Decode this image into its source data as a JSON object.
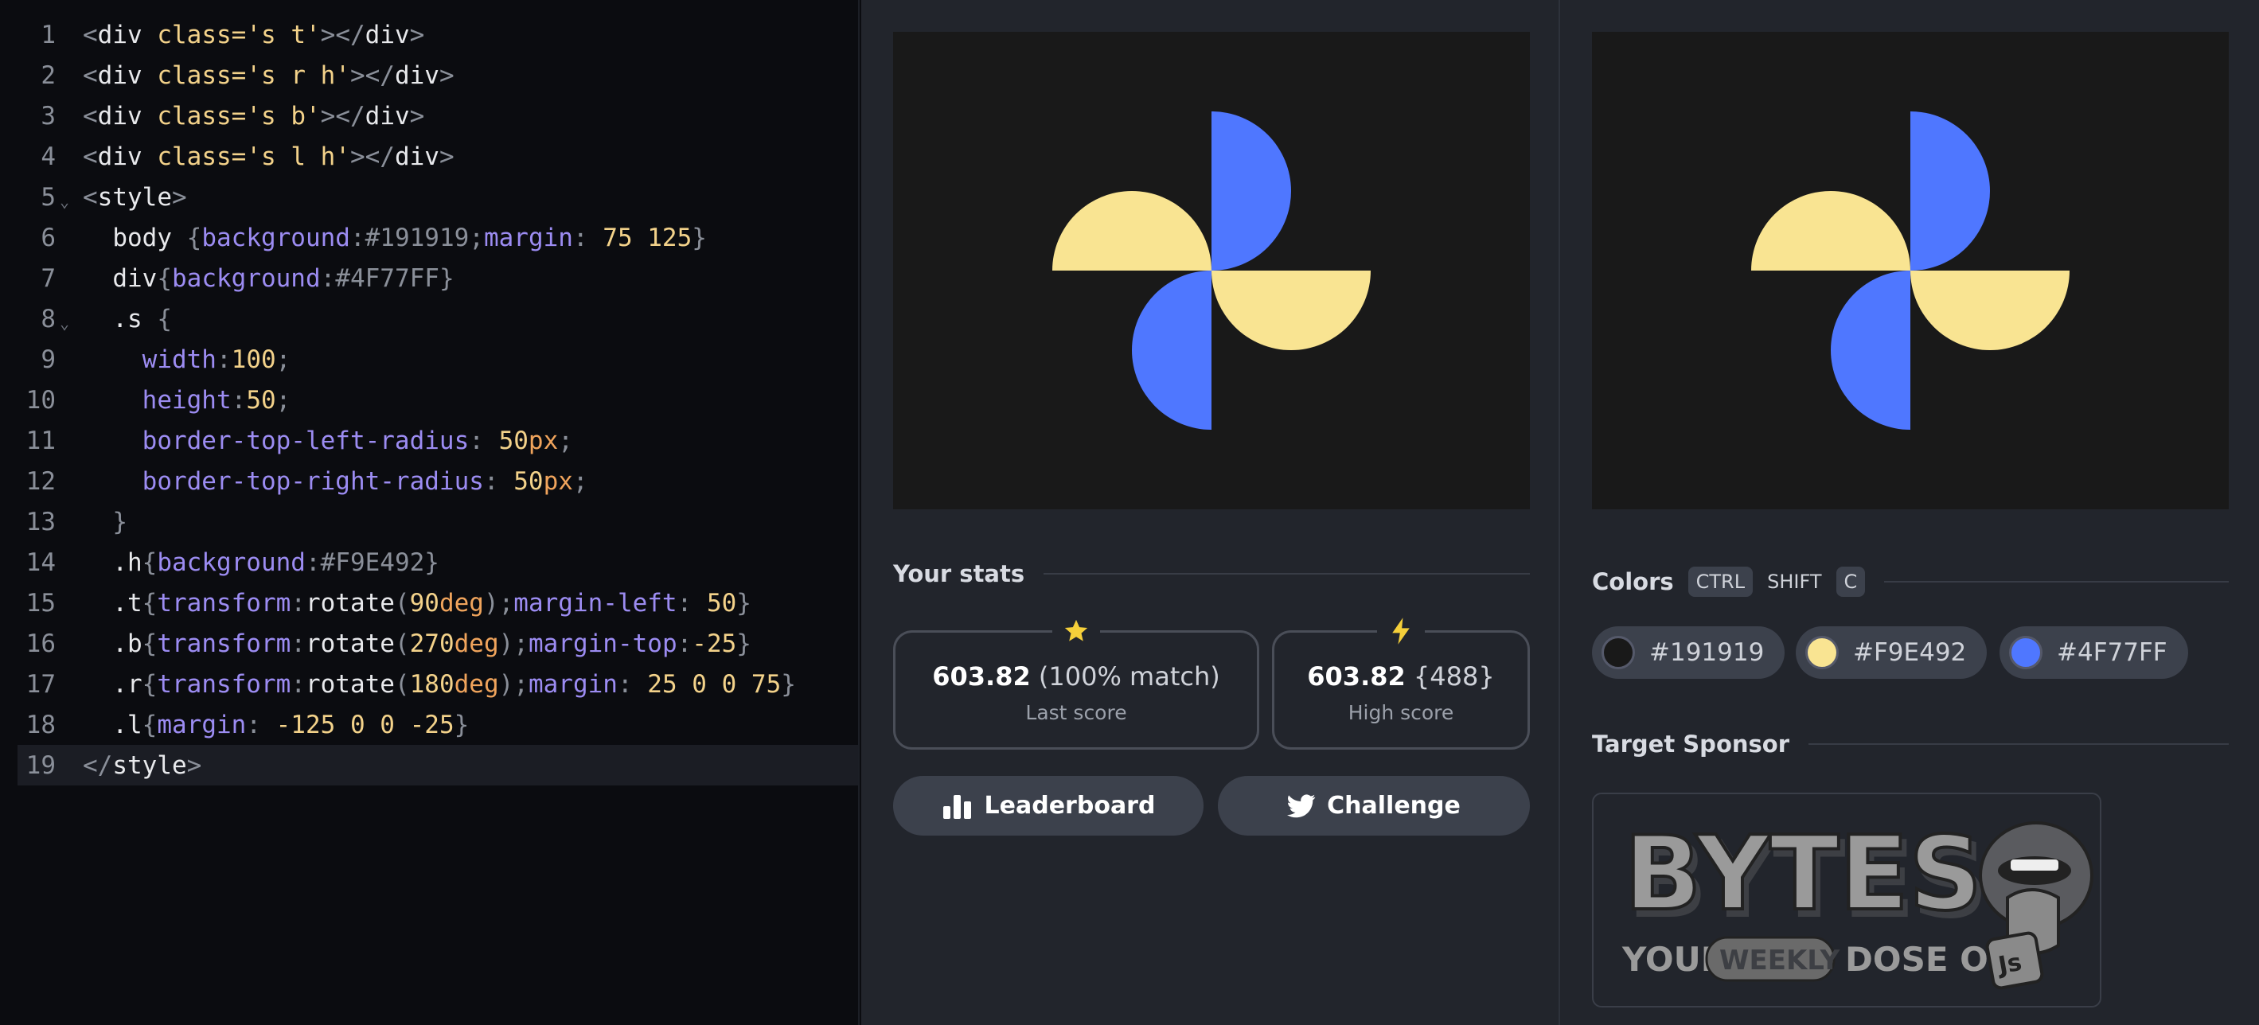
{
  "editor": {
    "lines": [
      {
        "n": "1",
        "fold": "",
        "parts": [
          [
            "pu",
            "<"
          ],
          [
            "tag",
            "div"
          ],
          [
            "tx",
            " "
          ],
          [
            "at",
            "class="
          ],
          [
            "st",
            "'s t'"
          ],
          [
            "pu",
            "></"
          ],
          [
            "tag",
            "div"
          ],
          [
            "pu",
            ">"
          ]
        ]
      },
      {
        "n": "2",
        "fold": "",
        "parts": [
          [
            "pu",
            "<"
          ],
          [
            "tag",
            "div"
          ],
          [
            "tx",
            " "
          ],
          [
            "at",
            "class="
          ],
          [
            "st",
            "'s r h'"
          ],
          [
            "pu",
            "></"
          ],
          [
            "tag",
            "div"
          ],
          [
            "pu",
            ">"
          ]
        ]
      },
      {
        "n": "3",
        "fold": "",
        "parts": [
          [
            "pu",
            "<"
          ],
          [
            "tag",
            "div"
          ],
          [
            "tx",
            " "
          ],
          [
            "at",
            "class="
          ],
          [
            "st",
            "'s b'"
          ],
          [
            "pu",
            "></"
          ],
          [
            "tag",
            "div"
          ],
          [
            "pu",
            ">"
          ]
        ]
      },
      {
        "n": "4",
        "fold": "",
        "parts": [
          [
            "pu",
            "<"
          ],
          [
            "tag",
            "div"
          ],
          [
            "tx",
            " "
          ],
          [
            "at",
            "class="
          ],
          [
            "st",
            "'s l h'"
          ],
          [
            "pu",
            "></"
          ],
          [
            "tag",
            "div"
          ],
          [
            "pu",
            ">"
          ]
        ]
      },
      {
        "n": "5",
        "fold": "⌄",
        "parts": [
          [
            "pu",
            "<"
          ],
          [
            "tag",
            "style"
          ],
          [
            "pu",
            ">"
          ]
        ]
      },
      {
        "n": "6",
        "fold": "",
        "parts": [
          [
            "tx",
            "  body "
          ],
          [
            "pu",
            "{"
          ],
          [
            "pr",
            "background"
          ],
          [
            "pu",
            ":"
          ],
          [
            "va",
            "#191919"
          ],
          [
            "pu",
            ";"
          ],
          [
            "pr",
            "margin"
          ],
          [
            "pu",
            ": "
          ],
          [
            "nu",
            "75 125"
          ],
          [
            "pu",
            "}"
          ]
        ]
      },
      {
        "n": "7",
        "fold": "",
        "parts": [
          [
            "tx",
            "  div"
          ],
          [
            "pu",
            "{"
          ],
          [
            "pr",
            "background"
          ],
          [
            "pu",
            ":"
          ],
          [
            "va",
            "#4F77FF"
          ],
          [
            "pu",
            "}"
          ]
        ]
      },
      {
        "n": "8",
        "fold": "⌄",
        "parts": [
          [
            "tx",
            "  .s "
          ],
          [
            "pu",
            "{"
          ]
        ]
      },
      {
        "n": "9",
        "fold": "",
        "parts": [
          [
            "tx",
            "    "
          ],
          [
            "pr",
            "width"
          ],
          [
            "pu",
            ":"
          ],
          [
            "nu",
            "100"
          ],
          [
            "pu",
            ";"
          ]
        ]
      },
      {
        "n": "10",
        "fold": "",
        "parts": [
          [
            "tx",
            "    "
          ],
          [
            "pr",
            "height"
          ],
          [
            "pu",
            ":"
          ],
          [
            "nu",
            "50"
          ],
          [
            "pu",
            ";"
          ]
        ]
      },
      {
        "n": "11",
        "fold": "",
        "parts": [
          [
            "tx",
            "    "
          ],
          [
            "pr",
            "border-top-left-radius"
          ],
          [
            "pu",
            ": "
          ],
          [
            "nu",
            "50"
          ],
          [
            "un",
            "px"
          ],
          [
            "pu",
            ";"
          ]
        ]
      },
      {
        "n": "12",
        "fold": "",
        "parts": [
          [
            "tx",
            "    "
          ],
          [
            "pr",
            "border-top-right-radius"
          ],
          [
            "pu",
            ": "
          ],
          [
            "nu",
            "50"
          ],
          [
            "un",
            "px"
          ],
          [
            "pu",
            ";"
          ]
        ]
      },
      {
        "n": "13",
        "fold": "",
        "parts": [
          [
            "pu",
            "  }"
          ]
        ]
      },
      {
        "n": "14",
        "fold": "",
        "parts": [
          [
            "tx",
            "  .h"
          ],
          [
            "pu",
            "{"
          ],
          [
            "pr",
            "background"
          ],
          [
            "pu",
            ":"
          ],
          [
            "va",
            "#F9E492"
          ],
          [
            "pu",
            "}"
          ]
        ]
      },
      {
        "n": "15",
        "fold": "",
        "parts": [
          [
            "tx",
            "  .t"
          ],
          [
            "pu",
            "{"
          ],
          [
            "pr",
            "transform"
          ],
          [
            "pu",
            ":"
          ],
          [
            "tx",
            "rotate"
          ],
          [
            "pu",
            "("
          ],
          [
            "nu",
            "90"
          ],
          [
            "un",
            "deg"
          ],
          [
            "pu",
            ");"
          ],
          [
            "pr",
            "margin-left"
          ],
          [
            "pu",
            ": "
          ],
          [
            "nu",
            "50"
          ],
          [
            "pu",
            "}"
          ]
        ]
      },
      {
        "n": "16",
        "fold": "",
        "parts": [
          [
            "tx",
            "  .b"
          ],
          [
            "pu",
            "{"
          ],
          [
            "pr",
            "transform"
          ],
          [
            "pu",
            ":"
          ],
          [
            "tx",
            "rotate"
          ],
          [
            "pu",
            "("
          ],
          [
            "nu",
            "270"
          ],
          [
            "un",
            "deg"
          ],
          [
            "pu",
            ");"
          ],
          [
            "pr",
            "margin-top"
          ],
          [
            "pu",
            ":"
          ],
          [
            "nu",
            "-25"
          ],
          [
            "pu",
            "}"
          ]
        ]
      },
      {
        "n": "17",
        "fold": "",
        "parts": [
          [
            "tx",
            "  .r"
          ],
          [
            "pu",
            "{"
          ],
          [
            "pr",
            "transform"
          ],
          [
            "pu",
            ":"
          ],
          [
            "tx",
            "rotate"
          ],
          [
            "pu",
            "("
          ],
          [
            "nu",
            "180"
          ],
          [
            "un",
            "deg"
          ],
          [
            "pu",
            ");"
          ],
          [
            "pr",
            "margin"
          ],
          [
            "pu",
            ": "
          ],
          [
            "nu",
            "25 0 0 75"
          ],
          [
            "pu",
            "}"
          ]
        ]
      },
      {
        "n": "18",
        "fold": "",
        "parts": [
          [
            "tx",
            "  .l"
          ],
          [
            "pu",
            "{"
          ],
          [
            "pr",
            "margin"
          ],
          [
            "pu",
            ": "
          ],
          [
            "nu",
            "-125 0 0 -25"
          ],
          [
            "pu",
            "}"
          ]
        ]
      },
      {
        "n": "19",
        "fold": "",
        "parts": [
          [
            "pu",
            "</"
          ],
          [
            "tag",
            "style"
          ],
          [
            "pu",
            ">"
          ]
        ]
      }
    ]
  },
  "stats": {
    "title": "Your stats",
    "last_score": "603.82",
    "last_match": "(100% match)",
    "last_label": "Last score",
    "high_score": "603.82",
    "high_chars": "{488}",
    "high_label": "High score",
    "leaderboard_label": "Leaderboard",
    "challenge_label": "Challenge",
    "star_icon": "star-icon",
    "bolt_icon": "bolt-icon"
  },
  "colors": {
    "title": "Colors",
    "shortcut_ctrl": "CTRL",
    "shortcut_shift": "SHIFT",
    "shortcut_c": "C",
    "swatches": [
      {
        "hex": "#191919"
      },
      {
        "hex": "#F9E492"
      },
      {
        "hex": "#4F77FF"
      }
    ]
  },
  "sponsor": {
    "title": "Target Sponsor",
    "logo_text": "BYTES",
    "tagline_1": "YOUR",
    "tagline_weekly": "WEEKLY",
    "tagline_2": "DOSE OF",
    "badge": "Js"
  }
}
